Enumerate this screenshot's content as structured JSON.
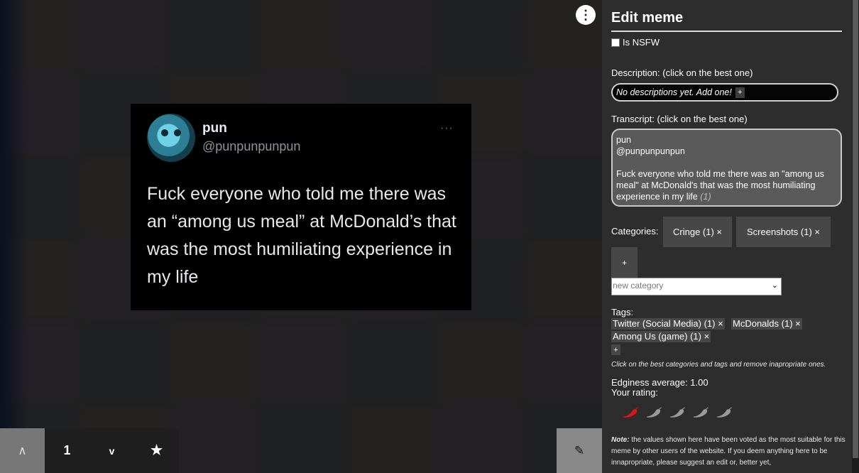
{
  "tweet": {
    "name": "pun",
    "handle": "@punpunpunpun",
    "more": "···",
    "text": "Fuck everyone who told me there was an “among us meal” at McDonald’s that was the most humiliating experience in my life"
  },
  "nav": {
    "up": "∧",
    "page": "1",
    "down": "v",
    "fav": "★",
    "edit": "✎"
  },
  "menu": {
    "dots": "⋮"
  },
  "panel": {
    "title": "Edit meme",
    "nsfw_label": "Is NSFW",
    "description_label": "Description: (click on the best one)",
    "description_empty": "No descriptions yet. Add one!",
    "plus": "+",
    "transcript_label": "Transcript: (click on the best one)",
    "transcript_line1": "pun",
    "transcript_line2": "@punpunpunpun",
    "transcript_body": "Fuck everyone who told me there was an \"among us meal\" at McDonald's that was the most humiliating experience in my life",
    "transcript_count": "(1)",
    "categories_label": "Categories:",
    "categories": [
      "Cringe (1) ×",
      "Screenshots (1) ×"
    ],
    "new_category_placeholder": "new category",
    "tags_label": "Tags:",
    "tags": [
      "Twitter (Social Media) (1) ×",
      "McDonalds (1) ×",
      "Among Us (game) (1) ×"
    ],
    "hint": "Click on the best categories and tags and remove inapropriate ones.",
    "edginess": "Edginess average: 1.00",
    "your_rating": "Your rating:",
    "rating": {
      "value": 1,
      "max": 5,
      "active_color": "#e01515",
      "inactive_color": "#9a9a9a"
    },
    "note_bold": "Note:",
    "note_text": " the values shown here have been voted as the most suitable for this meme by other users of the website. If you deem anything here to be innapropriate, please suggest an edit or, better yet,"
  }
}
